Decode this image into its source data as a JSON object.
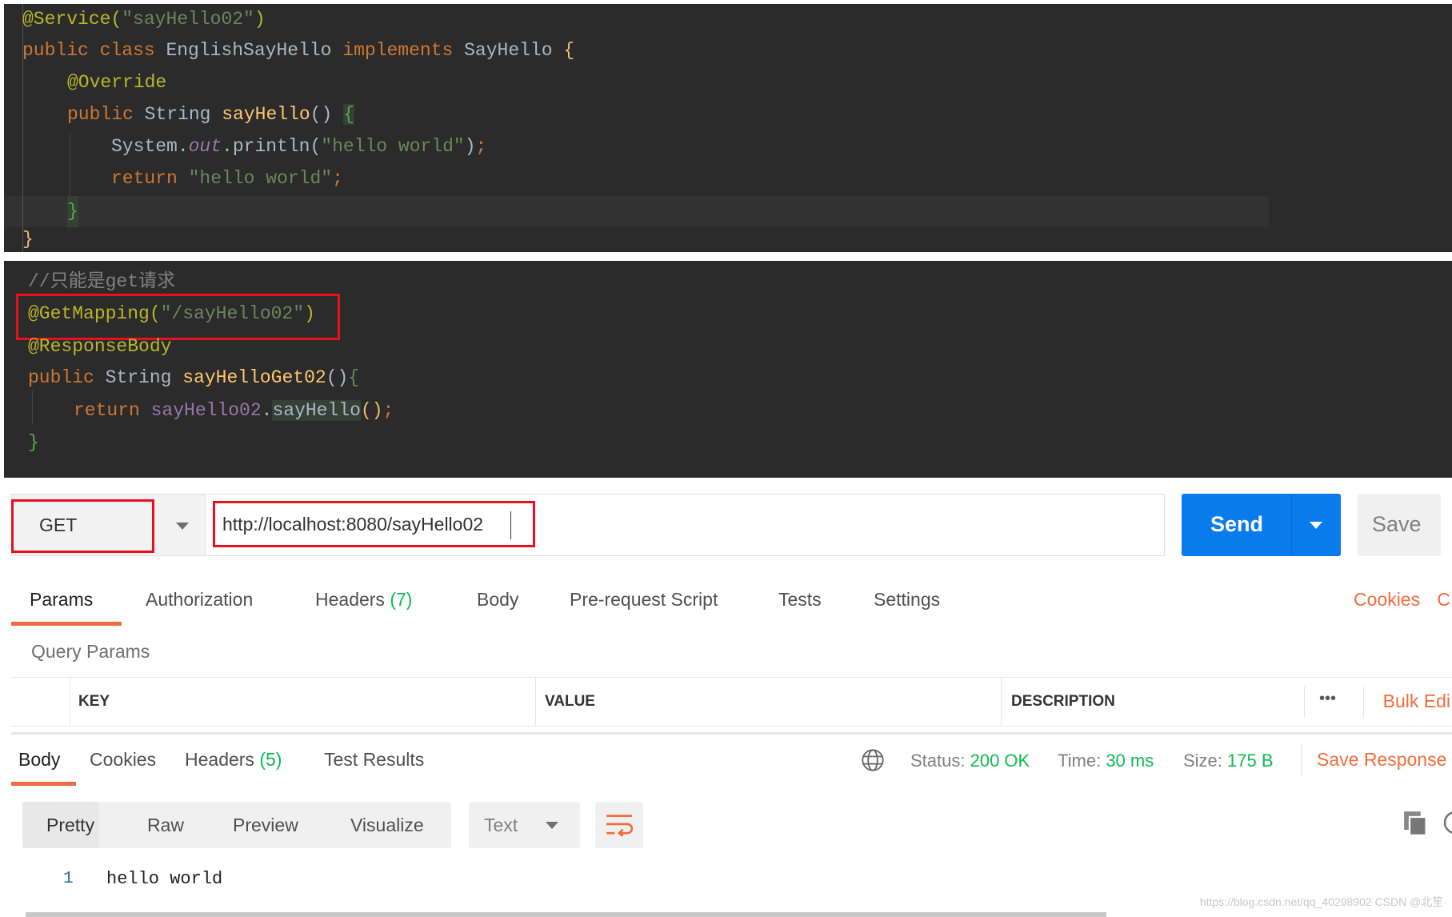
{
  "editor1": {
    "lines": [
      "@Service(\"sayHello02\")",
      "public class EnglishSayHello implements SayHello {",
      "@Override",
      "public String sayHello() {",
      "System.out.println(\"hello world\");",
      "return \"hello world\";",
      "}",
      "}"
    ]
  },
  "editor2": {
    "comment": "//只能是get请求",
    "mapping": "@GetMapping(\"/sayHello02\")",
    "response_body": "@ResponseBody",
    "signature": "public String sayHelloGet02(){",
    "return_line": "return sayHello02.sayHello();",
    "close": "}"
  },
  "request": {
    "method": "GET",
    "url": "http://localhost:8080/sayHello02",
    "send_label": "Send",
    "save_label": "Save"
  },
  "request_tabs": [
    {
      "label": "Params",
      "active": true
    },
    {
      "label": "Authorization"
    },
    {
      "label": "Headers",
      "count": "(7)"
    },
    {
      "label": "Body"
    },
    {
      "label": "Pre-request Script"
    },
    {
      "label": "Tests"
    },
    {
      "label": "Settings"
    }
  ],
  "cookies_link": "Cookies",
  "code_link": "C",
  "query_params": {
    "title": "Query Params",
    "columns": [
      "KEY",
      "VALUE",
      "DESCRIPTION"
    ],
    "more": "•••",
    "bulk_edit": "Bulk Edi"
  },
  "response": {
    "tabs": [
      {
        "label": "Body",
        "active": true
      },
      {
        "label": "Cookies"
      },
      {
        "label": "Headers",
        "count": "(5)"
      },
      {
        "label": "Test Results"
      }
    ],
    "status_label": "Status:",
    "status": "200 OK",
    "time_label": "Time:",
    "time": "30 ms",
    "size_label": "Size:",
    "size": "175 B",
    "save_response": "Save Response",
    "views": [
      "Pretty",
      "Raw",
      "Preview",
      "Visualize"
    ],
    "format": "Text",
    "body_lines": [
      {
        "n": "1",
        "text": "hello world"
      }
    ]
  },
  "watermark": "https://blog.csdn.net/qq_40298902  CSDN @北笙·",
  "colors": {
    "accent": "#f26b3a",
    "send": "#097bed",
    "success": "#0cbb52",
    "highlight": "#e8101c"
  }
}
